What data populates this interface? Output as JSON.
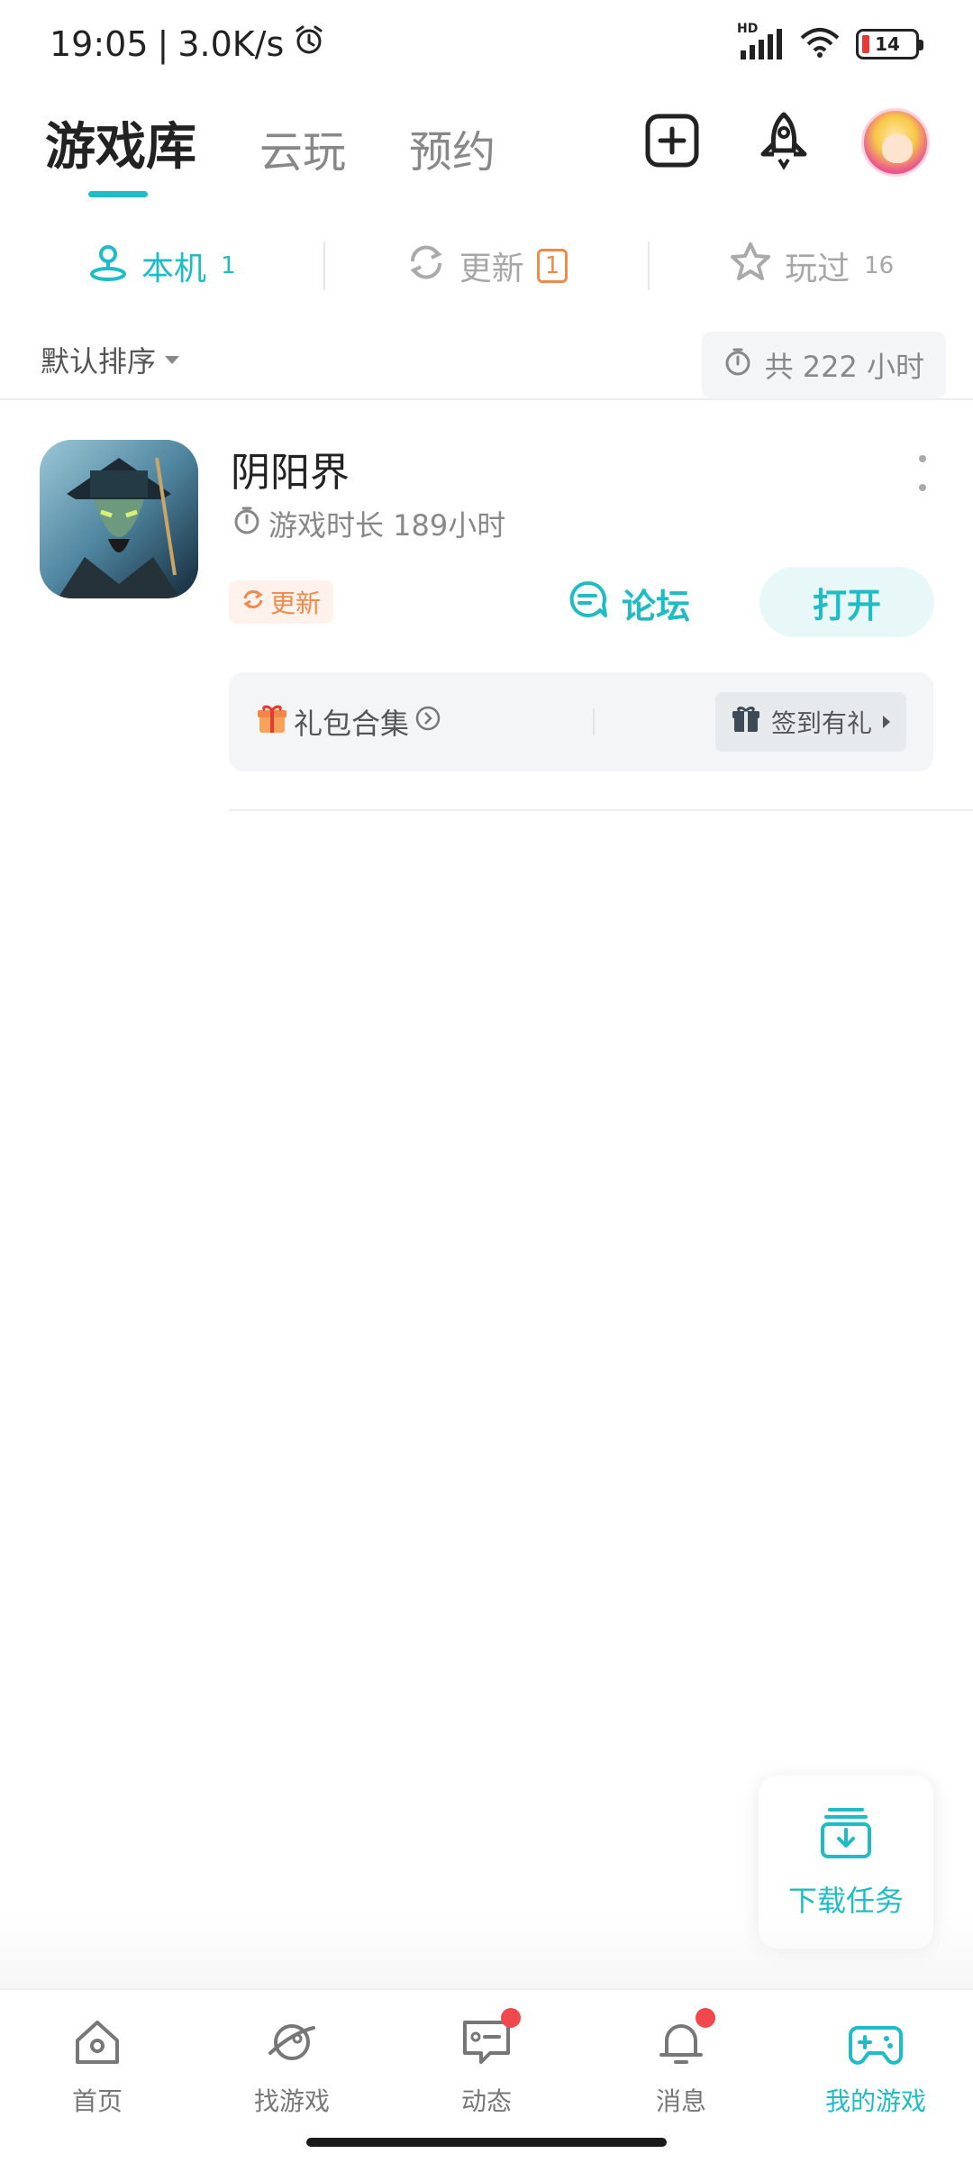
{
  "status_bar": {
    "time": "19:05",
    "speed": "3.0K/s",
    "network": "HD",
    "battery": "14",
    "battery_color": "#e53935"
  },
  "top_tabs": [
    {
      "label": "游戏库",
      "active": true
    },
    {
      "label": "云玩",
      "active": false
    },
    {
      "label": "预约",
      "active": false
    }
  ],
  "top_actions": {
    "add_icon": "plus-square-icon",
    "rocket_icon": "rocket-icon",
    "avatar": "avatar"
  },
  "sub_tabs": [
    {
      "label": "本机",
      "count": "1",
      "icon": "local-device-icon",
      "active": true
    },
    {
      "label": "更新",
      "count": "1",
      "icon": "refresh-icon",
      "active": false
    },
    {
      "label": "玩过",
      "count": "16",
      "icon": "star-icon",
      "active": false
    }
  ],
  "sort": {
    "label": "默认排序",
    "total_time": "共 222 小时"
  },
  "game": {
    "title": "阴阳界",
    "duration": "游戏时长 189小时",
    "update_label": "更新",
    "forum_label": "论坛",
    "open_label": "打开",
    "gift_label": "礼包合集",
    "signin_label": "签到有礼"
  },
  "download_task": {
    "label": "下载任务"
  },
  "bottom_nav": [
    {
      "label": "首页",
      "icon": "home-icon",
      "active": false,
      "dot": false
    },
    {
      "label": "找游戏",
      "icon": "planet-icon",
      "active": false,
      "dot": false
    },
    {
      "label": "动态",
      "icon": "feed-icon",
      "active": false,
      "dot": true
    },
    {
      "label": "消息",
      "icon": "bell-icon",
      "active": false,
      "dot": true
    },
    {
      "label": "我的游戏",
      "icon": "gamepad-icon",
      "active": true,
      "dot": false
    }
  ],
  "colors": {
    "accent": "#1fbcc5",
    "update": "#f08a4b",
    "dot": "#f0484c"
  }
}
